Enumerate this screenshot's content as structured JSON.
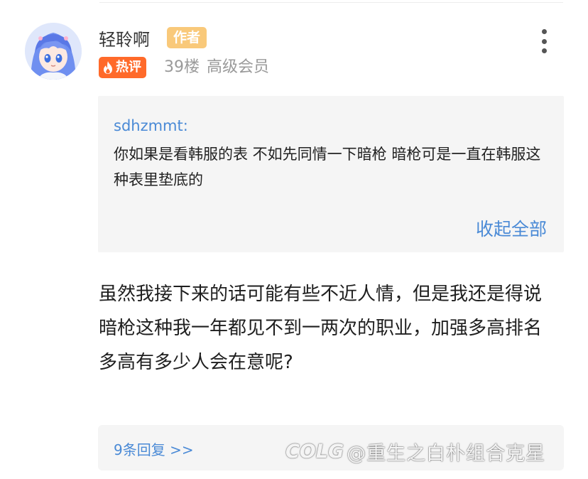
{
  "post": {
    "username": "轻聆啊",
    "author_badge": "作者",
    "hot_badge": "热评",
    "floor": "39楼",
    "level": "高级会员"
  },
  "quote": {
    "author": "sdhzmmt:",
    "text": "你如果是看韩服的表 不如先同情一下暗枪 暗枪可是一直在韩服这种表里垫底的",
    "collapse_label": "收起全部"
  },
  "content": {
    "text": "虽然我接下来的话可能有些不近人情，但是我还是得说\n暗枪这种我一年都见不到一两次的职业，加强多高排名多高有多少人会在意呢?"
  },
  "replies": {
    "label": "9条回复 >>"
  },
  "watermark": {
    "logo": "COLG",
    "text": "@重生之白朴组合克星"
  },
  "colors": {
    "link_blue": "#4a8ad6",
    "author_badge_bg": "#f9c97a",
    "hot_badge_bg": "#ff6a2a"
  },
  "icons": {
    "hot": "flame-icon",
    "more": "more-vertical-icon",
    "avatar": "anime-avatar"
  }
}
